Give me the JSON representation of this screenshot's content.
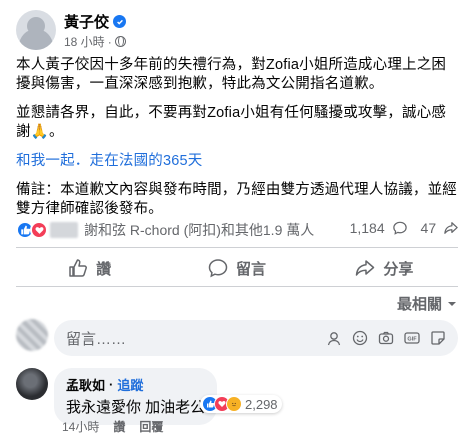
{
  "post": {
    "author": "黃子佼",
    "time": "18 小時",
    "paragraph1": "本人黃子佼因十多年前的失禮行為，對Zofia小姐所造成心理上之困擾與傷害，一直深深感到抱歉，特此為文公開指名道歉。",
    "paragraph2": "並懇請各界，自此，不要再對Zofia小姐有任何騷擾或攻擊，誠心感謝🙏。",
    "hashtags": "和我一起．走在法國的365天",
    "paragraph4": "備註：本道歉文內容與發布時間，乃經由雙方透過代理人協議，並經雙方律師確認後發布。"
  },
  "reactions": {
    "names_text": "謝和弦 R-chord (阿扣)和其他1.9 萬人",
    "comment_count": "1,184",
    "share_count": "47"
  },
  "actions": {
    "like": "讚",
    "comment": "留言",
    "share": "分享"
  },
  "sort_label": "最相關",
  "comment_input": {
    "placeholder": "留言……"
  },
  "comment": {
    "name": "孟耿如",
    "follow": "追蹤",
    "text": "我永遠愛你 加油老公",
    "reaction_count": "2,298",
    "time": "14小時",
    "like": "讚",
    "reply": "回覆"
  },
  "colors": {
    "accent": "#1877f2",
    "link": "#216fdb",
    "love": "#f33e58",
    "secondary_text": "#65676b"
  },
  "icons": [
    "verified-icon",
    "globe-icon",
    "like-icon",
    "love-icon",
    "comment-icon",
    "share-icon",
    "chevron-down-icon",
    "emoji-icon",
    "camera-icon",
    "gif-icon",
    "sticker-icon",
    "prayer-icon"
  ]
}
